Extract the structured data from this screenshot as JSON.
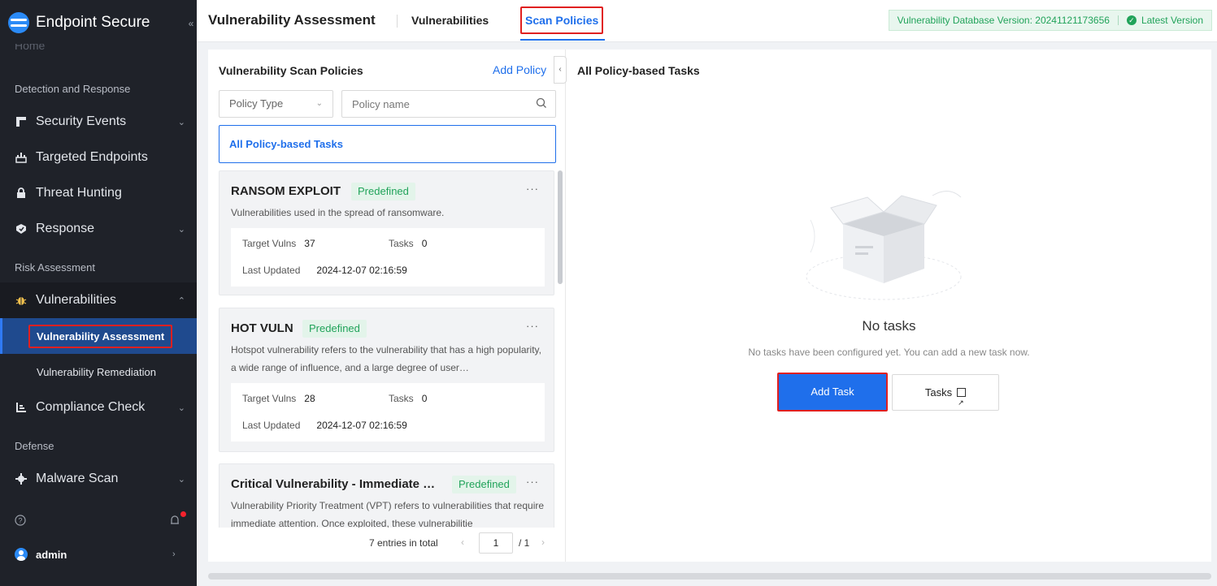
{
  "sidebar": {
    "brand": "Endpoint Secure",
    "collapse_icon": "«",
    "home_label": "Home",
    "sections": {
      "detection": "Detection and Response",
      "risk": "Risk Assessment",
      "defense": "Defense"
    },
    "items": {
      "security_events": "Security Events",
      "targeted_endpoints": "Targeted Endpoints",
      "threat_hunting": "Threat Hunting",
      "response": "Response",
      "vulnerabilities": "Vulnerabilities",
      "vuln_assessment": "Vulnerability Assessment",
      "vuln_remediation": "Vulnerability Remediation",
      "compliance_check": "Compliance Check",
      "malware_scan": "Malware Scan"
    },
    "user": "admin"
  },
  "header": {
    "title": "Vulnerability Assessment",
    "tabs": [
      "Vulnerabilities",
      "Scan Policies"
    ],
    "db_version": "Vulnerability Database Version: 20241121173656",
    "latest": "Latest Version"
  },
  "policies": {
    "title": "Vulnerability Scan Policies",
    "add_label": "Add Policy",
    "policy_type_placeholder": "Policy Type",
    "policy_name_placeholder": "Policy name",
    "all_tasks_label": "All Policy-based Tasks",
    "cards": [
      {
        "name": "RANSOM EXPLOIT",
        "badge": "Predefined",
        "desc": "Vulnerabilities used in the spread of ransomware.",
        "target_label": "Target Vulns",
        "target_value": "37",
        "tasks_label": "Tasks",
        "tasks_value": "0",
        "updated_label": "Last Updated",
        "updated_value": "2024-12-07 02:16:59"
      },
      {
        "name": "HOT VULN",
        "badge": "Predefined",
        "desc": "Hotspot vulnerability refers to the vulnerability that has a high popularity, a wide range of influence, and a large degree of user…",
        "target_label": "Target Vulns",
        "target_value": "28",
        "tasks_label": "Tasks",
        "tasks_value": "0",
        "updated_label": "Last Updated",
        "updated_value": "2024-12-07 02:16:59"
      },
      {
        "name": "Critical Vulnerability - Immediate …",
        "badge": "Predefined",
        "desc": "Vulnerability Priority Treatment (VPT) refers to vulnerabilities that require immediate attention. Once exploited, these vulnerabilitie"
      }
    ],
    "pager": {
      "total": "7 entries in total",
      "page": "1",
      "of": "/ 1"
    }
  },
  "tasks_panel": {
    "title": "All Policy-based Tasks",
    "empty_title": "No tasks",
    "empty_desc": "No tasks have been configured yet. You can add a new task now.",
    "add_task": "Add Task",
    "tasks_button": "Tasks"
  },
  "colors": {
    "primary": "#1f6feb",
    "sidebar_bg": "#1f2229",
    "success": "#21a35a",
    "highlight": "#e02020"
  }
}
